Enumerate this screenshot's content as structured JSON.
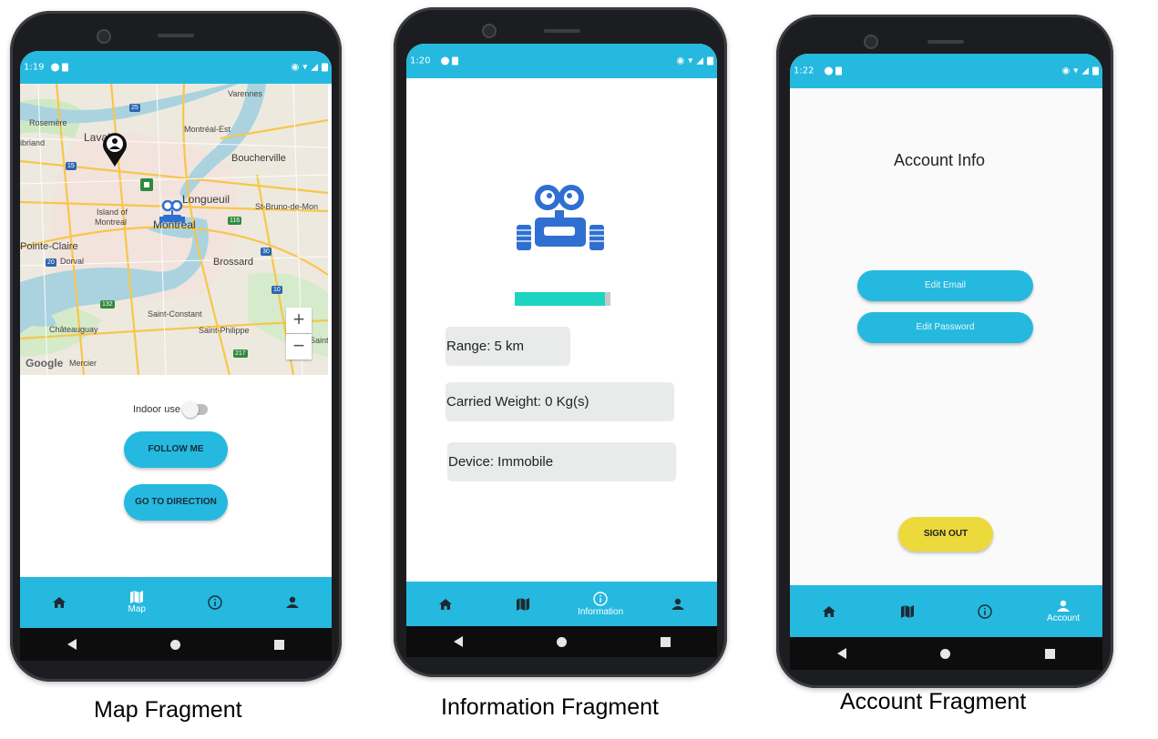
{
  "captions": {
    "map": "Map Fragment",
    "information": "Information Fragment",
    "account": "Account Fragment"
  },
  "map_screen": {
    "status_time": "1:19",
    "map_labels": {
      "varennes": "Varennes",
      "rosemere": "Rosemère",
      "laval": "Laval",
      "briand": "ibriand",
      "montreal_est": "Montréal-Est",
      "boucherville": "Boucherville",
      "longueuil": "Longueuil",
      "island": "Island of",
      "island2": "Montreal",
      "montreal": "Montréal",
      "st_bruno": "St-Bruno-de-Mon",
      "pointe_claire": "Pointe-Claire",
      "dorval": "Dorval",
      "brossard": "Brossard",
      "chateauguay": "Châteauguay",
      "saint_constant": "Saint-Constant",
      "saint_philippe": "Saint-Philippe",
      "mercier": "Mercier",
      "saint": "Saint-",
      "shields": [
        "25",
        "15",
        "20",
        "116",
        "30",
        "10",
        "132",
        "217"
      ]
    },
    "google_logo": "Google",
    "zoom_in": "+",
    "zoom_out": "−",
    "indoor_label": "Indoor use",
    "indoor_enabled": false,
    "follow_me": "FOLLOW ME",
    "go_to_direction": "GO TO DIRECTION",
    "nav": [
      {
        "icon": "home-icon",
        "label": ""
      },
      {
        "icon": "map-icon",
        "label": "Map",
        "active": true
      },
      {
        "icon": "info-icon",
        "label": ""
      },
      {
        "icon": "person-icon",
        "label": ""
      }
    ]
  },
  "info_screen": {
    "status_time": "1:20",
    "progress": 0.94,
    "range": "Range: 5 km",
    "weight": "Carried Weight: 0 Kg(s)",
    "device": "Device: Immobile",
    "nav": [
      {
        "icon": "home-icon",
        "label": ""
      },
      {
        "icon": "map-icon",
        "label": ""
      },
      {
        "icon": "info-icon",
        "label": "Information",
        "active": true
      },
      {
        "icon": "person-icon",
        "label": ""
      }
    ]
  },
  "account_screen": {
    "status_time": "1:22",
    "title": "Account Info",
    "edit_email": "Edit Email",
    "edit_password": "Edit Password",
    "sign_out": "SIGN OUT",
    "nav": [
      {
        "icon": "home-icon",
        "label": ""
      },
      {
        "icon": "map-icon",
        "label": ""
      },
      {
        "icon": "info-icon",
        "label": ""
      },
      {
        "icon": "person-icon",
        "label": "Account",
        "active": true
      }
    ]
  },
  "colors": {
    "accent": "#25b9df",
    "sign_out": "#ecd93c",
    "progress": "#1ed3c2",
    "robot": "#2f6fd1"
  }
}
